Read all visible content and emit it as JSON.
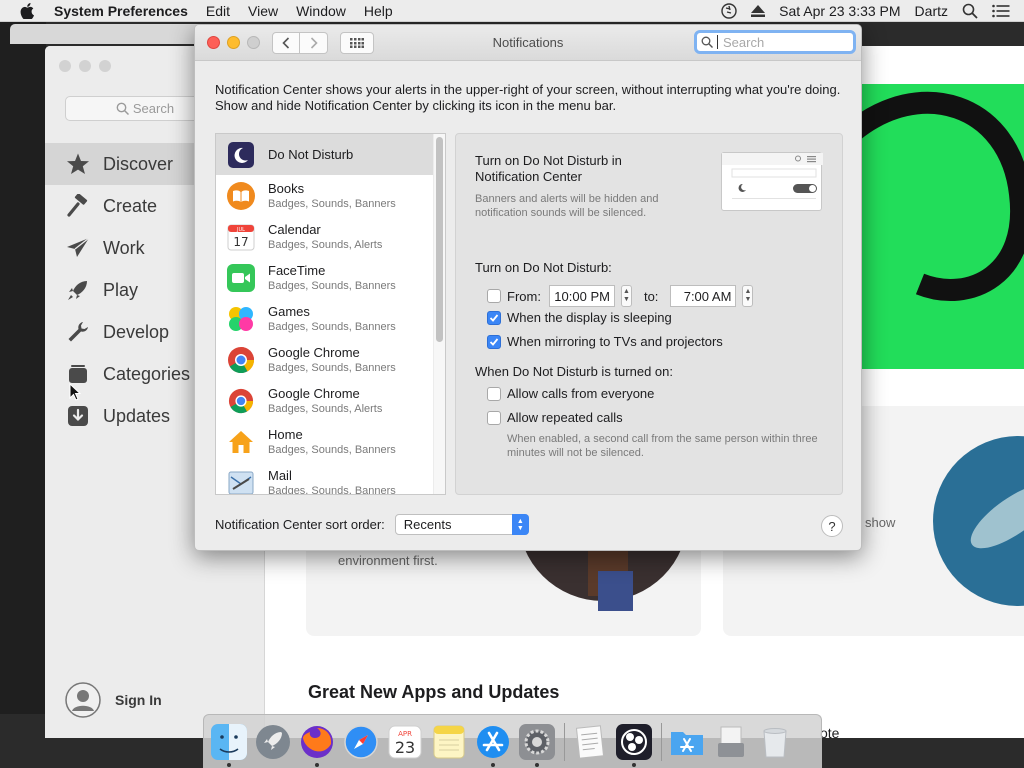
{
  "menubar": {
    "app_name": "System Preferences",
    "menus": [
      "Edit",
      "View",
      "Window",
      "Help"
    ],
    "datetime": "Sat Apr 23  3:33 PM",
    "user": "Dartz"
  },
  "appstore": {
    "search_placeholder": "Search",
    "nav": [
      {
        "label": "Discover",
        "icon": "star-icon"
      },
      {
        "label": "Create",
        "icon": "hammer-icon"
      },
      {
        "label": "Work",
        "icon": "paper-plane-icon"
      },
      {
        "label": "Play",
        "icon": "rocket-icon"
      },
      {
        "label": "Develop",
        "icon": "wrench-icon"
      },
      {
        "label": "Categories",
        "icon": "stack-icon"
      },
      {
        "label": "Updates",
        "icon": "download-icon"
      }
    ],
    "sign_in": "Sign In",
    "card_text_left": "environment first.",
    "card_text_right": "show",
    "section_title": "Great New Apps and Updates",
    "footer_text": "ote"
  },
  "prefs": {
    "title": "Notifications",
    "search_placeholder": "Search",
    "intro": "Notification Center shows your alerts in the upper-right of your screen, without interrupting what you're doing. Show and hide Notification Center by clicking its icon in the menu bar.",
    "apps": [
      {
        "name": "Do Not Disturb",
        "sub": "",
        "icon": "moon-icon"
      },
      {
        "name": "Books",
        "sub": "Badges, Sounds, Banners",
        "icon": "books-icon"
      },
      {
        "name": "Calendar",
        "sub": "Badges, Sounds, Alerts",
        "icon": "calendar-icon"
      },
      {
        "name": "FaceTime",
        "sub": "Badges, Sounds, Banners",
        "icon": "facetime-icon"
      },
      {
        "name": "Games",
        "sub": "Badges, Sounds, Banners",
        "icon": "games-icon"
      },
      {
        "name": "Google Chrome",
        "sub": "Badges, Sounds, Banners",
        "icon": "chrome-icon"
      },
      {
        "name": "Google Chrome",
        "sub": "Badges, Sounds, Alerts",
        "icon": "chrome-icon"
      },
      {
        "name": "Home",
        "sub": "Badges, Sounds, Banners",
        "icon": "home-icon"
      },
      {
        "name": "Mail",
        "sub": "Badges, Sounds, Banners",
        "icon": "mail-icon"
      }
    ],
    "calendar_month": "JUL",
    "calendar_day": "17",
    "detail": {
      "title": "Turn on Do Not Disturb in Notification Center",
      "desc": "Banners and alerts will be hidden and notification sounds will be silenced.",
      "turn_on_label": "Turn on Do Not Disturb:",
      "from_label": "From:",
      "from_time": "10:00 PM",
      "to_label": "to:",
      "to_time": "7:00 AM",
      "display_sleeping": "When the display is sleeping",
      "mirroring": "When mirroring to TVs and projectors",
      "when_on_label": "When Do Not Disturb is turned on:",
      "allow_calls": "Allow calls from everyone",
      "allow_repeated": "Allow repeated calls",
      "note": "When enabled, a second call from the same person within three minutes will not be silenced."
    },
    "sort_label": "Notification Center sort order:",
    "sort_value": "Recents",
    "help": "?"
  },
  "dock": {
    "calendar_month": "APR",
    "calendar_day": "23"
  },
  "colors": {
    "accent": "#3b86f6",
    "green_panel": "#22dd5a",
    "close": "#fd5f57",
    "minimize": "#febc2e"
  }
}
